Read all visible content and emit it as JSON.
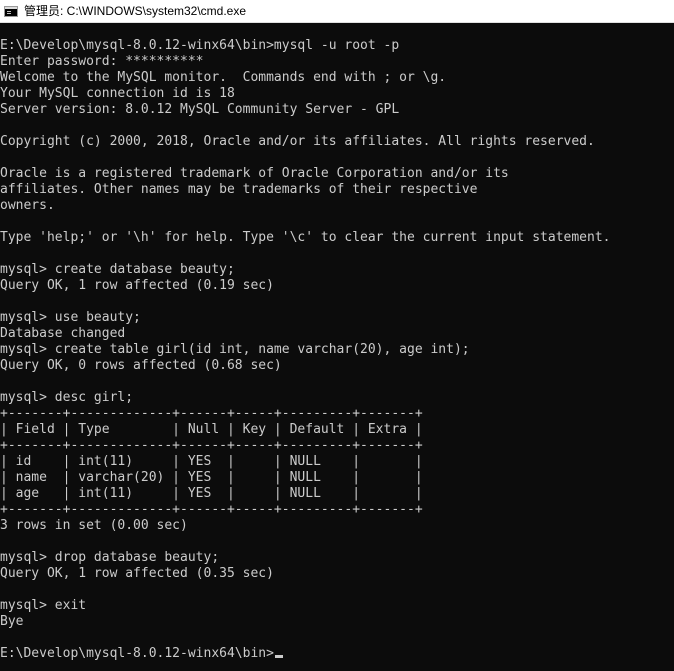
{
  "window": {
    "title": "管理员: C:\\WINDOWS\\system32\\cmd.exe"
  },
  "console": {
    "lines": [
      "E:\\Develop\\mysql-8.0.12-winx64\\bin>mysql -u root -p",
      "Enter password: **********",
      "Welcome to the MySQL monitor.  Commands end with ; or \\g.",
      "Your MySQL connection id is 18",
      "Server version: 8.0.12 MySQL Community Server - GPL",
      "",
      "Copyright (c) 2000, 2018, Oracle and/or its affiliates. All rights reserved.",
      "",
      "Oracle is a registered trademark of Oracle Corporation and/or its",
      "affiliates. Other names may be trademarks of their respective",
      "owners.",
      "",
      "Type 'help;' or '\\h' for help. Type '\\c' to clear the current input statement.",
      "",
      "mysql> create database beauty;",
      "Query OK, 1 row affected (0.19 sec)",
      "",
      "mysql> use beauty;",
      "Database changed",
      "mysql> create table girl(id int, name varchar(20), age int);",
      "Query OK, 0 rows affected (0.68 sec)",
      "",
      "mysql> desc girl;",
      "+-------+-------------+------+-----+---------+-------+",
      "| Field | Type        | Null | Key | Default | Extra |",
      "+-------+-------------+------+-----+---------+-------+",
      "| id    | int(11)     | YES  |     | NULL    |       |",
      "| name  | varchar(20) | YES  |     | NULL    |       |",
      "| age   | int(11)     | YES  |     | NULL    |       |",
      "+-------+-------------+------+-----+---------+-------+",
      "3 rows in set (0.00 sec)",
      "",
      "mysql> drop database beauty;",
      "Query OK, 1 row affected (0.35 sec)",
      "",
      "mysql> exit",
      "Bye",
      "",
      "E:\\Develop\\mysql-8.0.12-winx64\\bin>"
    ]
  }
}
